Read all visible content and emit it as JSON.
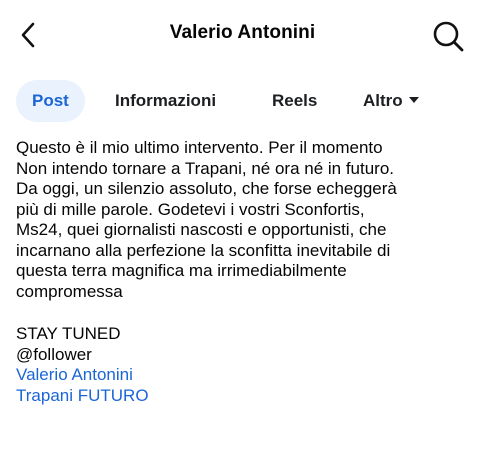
{
  "header": {
    "title": "Valerio Antonini",
    "back_icon": "chevron-left-icon",
    "search_icon": "search-icon"
  },
  "tabs": [
    {
      "label": "Post",
      "active": true
    },
    {
      "label": "Informazioni",
      "active": false
    },
    {
      "label": "Reels",
      "active": false
    },
    {
      "label": "Altro",
      "active": false,
      "icon": "caret-down-icon"
    }
  ],
  "post": {
    "lines": [
      "Questo è il mio ultimo intervento. Per il momento",
      "Non intendo tornare a Trapani, né ora né in futuro.",
      "Da oggi, un silenzio assoluto, che forse echeggerà",
      "più di mille parole. Godetevi i vostri Sconfortis,",
      "Ms24, quei giornalisti nascosti e opportunisti, che",
      "incarnano alla perfezione la sconfitta inevitabile di",
      "questa terra magnifica ma irrimediabilmente",
      "compromessa"
    ],
    "signoff": "STAY TUNED",
    "mention": "@follower",
    "tagged": [
      "Valerio Antonini",
      "Trapani FUTURO"
    ]
  },
  "colors": {
    "accent": "#1a66d6",
    "active_tab_bg": "#eaf2fd",
    "text": "#050505"
  }
}
